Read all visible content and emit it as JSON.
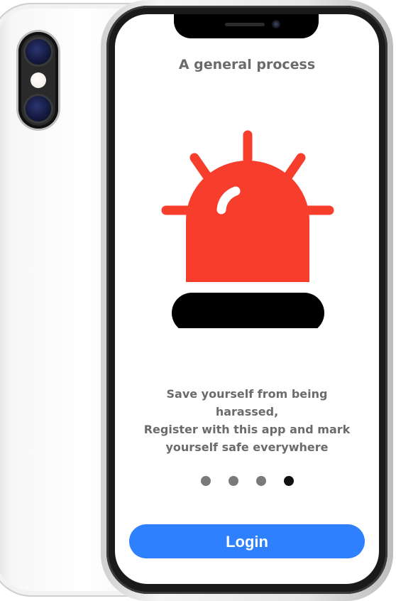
{
  "onboarding": {
    "title": "A general process",
    "message_lines": [
      "Save yourself from being harassed,",
      "Register with this app and mark",
      "yourself safe everywhere"
    ],
    "page_count": 4,
    "active_page": 4,
    "login_label": "Login"
  },
  "colors": {
    "siren_red": "#f73d2c",
    "siren_base": "#000000",
    "button_blue": "#2f80ff",
    "dot_inactive": "#7a7a7a",
    "dot_active": "#111111",
    "text_gray": "#6b6b6b"
  },
  "icons": {
    "illustration": "siren-alarm-icon"
  }
}
